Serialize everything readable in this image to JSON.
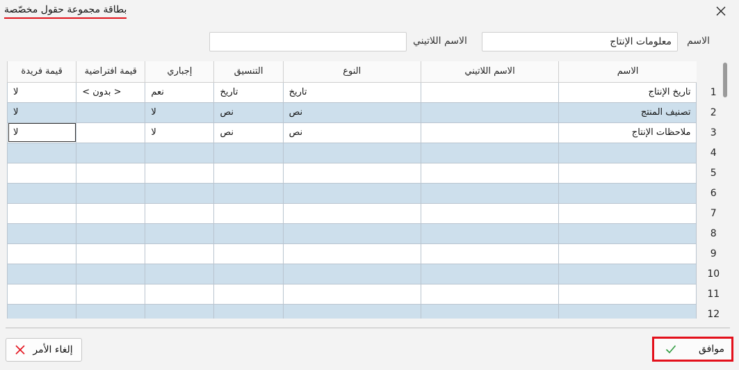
{
  "dialog": {
    "title": "بطاقة مجموعة حقول مخصّصة",
    "close_icon": "close-icon"
  },
  "form": {
    "name_label": "الاسم",
    "name_value": "معلومات الإنتاج",
    "latin_name_label": "الاسم اللاتيني",
    "latin_name_value": ""
  },
  "grid": {
    "columns": [
      "الاسم",
      "الاسم اللاتيني",
      "النوع",
      "التنسيق",
      "إجباري",
      "قيمة افتراضية",
      "قيمة فريدة"
    ],
    "rows": [
      {
        "num": "1",
        "cells": [
          "تاريخ الإنتاج",
          "",
          "تاريخ",
          "تاريخ",
          "نعم",
          "< بدون >",
          "لا"
        ]
      },
      {
        "num": "2",
        "cells": [
          "تصنيف المنتج",
          "",
          "نص",
          "نص",
          "لا",
          "",
          "لا"
        ]
      },
      {
        "num": "3",
        "cells": [
          "ملاحظات الإنتاج",
          "",
          "نص",
          "نص",
          "لا",
          "",
          "لا"
        ]
      },
      {
        "num": "4",
        "cells": [
          "",
          "",
          "",
          "",
          "",
          "",
          ""
        ]
      },
      {
        "num": "5",
        "cells": [
          "",
          "",
          "",
          "",
          "",
          "",
          ""
        ]
      },
      {
        "num": "6",
        "cells": [
          "",
          "",
          "",
          "",
          "",
          "",
          ""
        ]
      },
      {
        "num": "7",
        "cells": [
          "",
          "",
          "",
          "",
          "",
          "",
          ""
        ]
      },
      {
        "num": "8",
        "cells": [
          "",
          "",
          "",
          "",
          "",
          "",
          ""
        ]
      },
      {
        "num": "9",
        "cells": [
          "",
          "",
          "",
          "",
          "",
          "",
          ""
        ]
      },
      {
        "num": "10",
        "cells": [
          "",
          "",
          "",
          "",
          "",
          "",
          ""
        ]
      },
      {
        "num": "11",
        "cells": [
          "",
          "",
          "",
          "",
          "",
          "",
          ""
        ]
      },
      {
        "num": "12",
        "cells": [
          "",
          "",
          "",
          "",
          "",
          "",
          ""
        ]
      }
    ]
  },
  "buttons": {
    "ok_label": "موافق",
    "ok_icon": "checkmark-icon",
    "cancel_label": "إلغاء الأمر",
    "cancel_icon": "x-icon"
  },
  "colors": {
    "accent_red": "#e3101b",
    "row_highlight": "#cddfec",
    "check_green": "#2e9a3e"
  }
}
